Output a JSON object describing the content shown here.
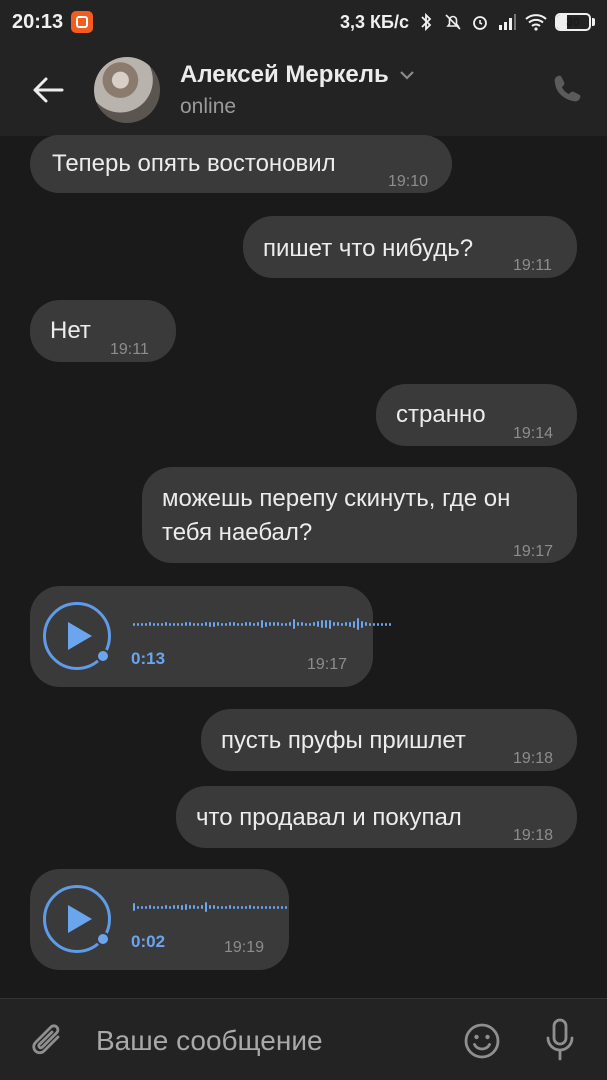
{
  "status_bar": {
    "time": "20:13",
    "speed": "3,3 КБ/с",
    "battery": "30",
    "battery_level": 0.3,
    "icons": [
      "app-notification-icon",
      "bluetooth-icon",
      "mute-icon",
      "alarm-icon",
      "signal-icon",
      "wifi-icon",
      "battery-icon"
    ]
  },
  "header": {
    "contact_name": "Алексей Меркель",
    "status": "online",
    "icons": [
      "back-arrow-icon",
      "chevron-down-icon",
      "phone-icon"
    ]
  },
  "messages": [
    {
      "direction": "in",
      "type": "text",
      "text": "Теперь опять востоновил",
      "time": "19:10"
    },
    {
      "direction": "out",
      "type": "text",
      "text": "пишет что нибудь?",
      "time": "19:11"
    },
    {
      "direction": "in",
      "type": "text",
      "text": "Нет",
      "time": "19:11"
    },
    {
      "direction": "out",
      "type": "text",
      "text": "странно",
      "time": "19:14"
    },
    {
      "direction": "out",
      "type": "text",
      "text_line1": "можешь перепу скинуть, где он",
      "text_line2": "тебя наебал?",
      "time": "19:17"
    },
    {
      "direction": "in",
      "type": "voice",
      "duration": "0:13",
      "time": "19:17"
    },
    {
      "direction": "out",
      "type": "text",
      "text": "пусть пруфы пришлет",
      "time": "19:18"
    },
    {
      "direction": "out",
      "type": "text",
      "text": "что продавал и покупал",
      "time": "19:18"
    },
    {
      "direction": "in",
      "type": "voice",
      "duration": "0:02",
      "time": "19:19"
    }
  ],
  "composer": {
    "placeholder": "Ваше сообщение",
    "icons": [
      "attach-icon",
      "emoji-icon",
      "microphone-icon"
    ]
  },
  "colors": {
    "background": "#1a1a1a",
    "bar": "#232323",
    "bubble": "#3a3a3a",
    "accent": "#6aa5ee"
  }
}
